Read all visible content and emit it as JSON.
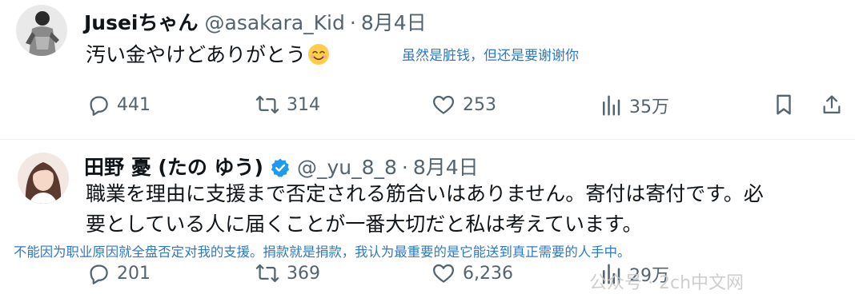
{
  "tweets": [
    {
      "display_name": "Juseiちゃん",
      "handle": "@asakara_Kid",
      "separator": "·",
      "date": "8月4日",
      "text": "汚い金やけどありがとう",
      "emoji": "smiling-face-with-smiling-eyes",
      "translation": "虽然是脏钱，但还是要谢谢你",
      "actions": {
        "replies": "441",
        "retweets": "314",
        "likes": "253",
        "views": "35万"
      }
    },
    {
      "display_name": "田野 憂 (たの ゆう)",
      "verified": true,
      "handle": "@_yu_8_8",
      "separator": "·",
      "date": "8月4日",
      "text_lines": [
        "職業を理由に支援まで否定される筋合いはありません。寄付は寄付です。必",
        "要としている人に届くことが一番大切だと私は考えています。"
      ],
      "translation": "不能因为职业原因就全盘否定对我的支援。捐款就是捐款，我认为最重要的是它能送到真正需要的人手中。",
      "actions": {
        "replies": "201",
        "retweets": "369",
        "likes": "6,236",
        "views": "29万"
      }
    }
  ],
  "watermark": "公众号 · 2ch中文网",
  "colors": {
    "text": "#0f1419",
    "muted": "#536471",
    "translation": "#2f78c4",
    "verified": "#1d9bf0"
  }
}
